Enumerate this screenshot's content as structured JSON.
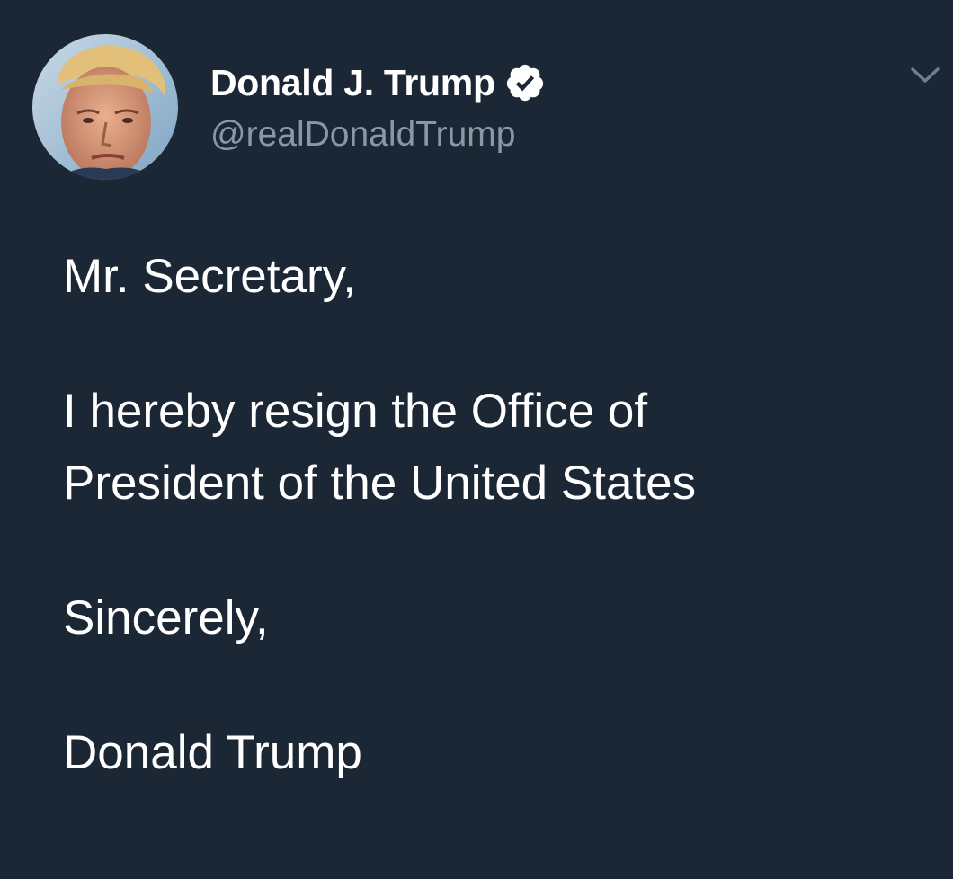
{
  "author": {
    "display_name": "Donald J. Trump",
    "handle": "@realDonaldTrump",
    "verified": true,
    "avatar_icon": "profile-photo"
  },
  "menu": {
    "icon": "chevron-down-icon"
  },
  "tweet": {
    "paragraphs": [
      "Mr. Secretary,",
      "I hereby resign the Office of",
      "President of the United States",
      "Sincerely,",
      "Donald Trump"
    ]
  },
  "colors": {
    "background": "#1c2735",
    "text": "#ffffff",
    "secondary_text": "#8899a6",
    "verified_badge": "#ffffff"
  }
}
